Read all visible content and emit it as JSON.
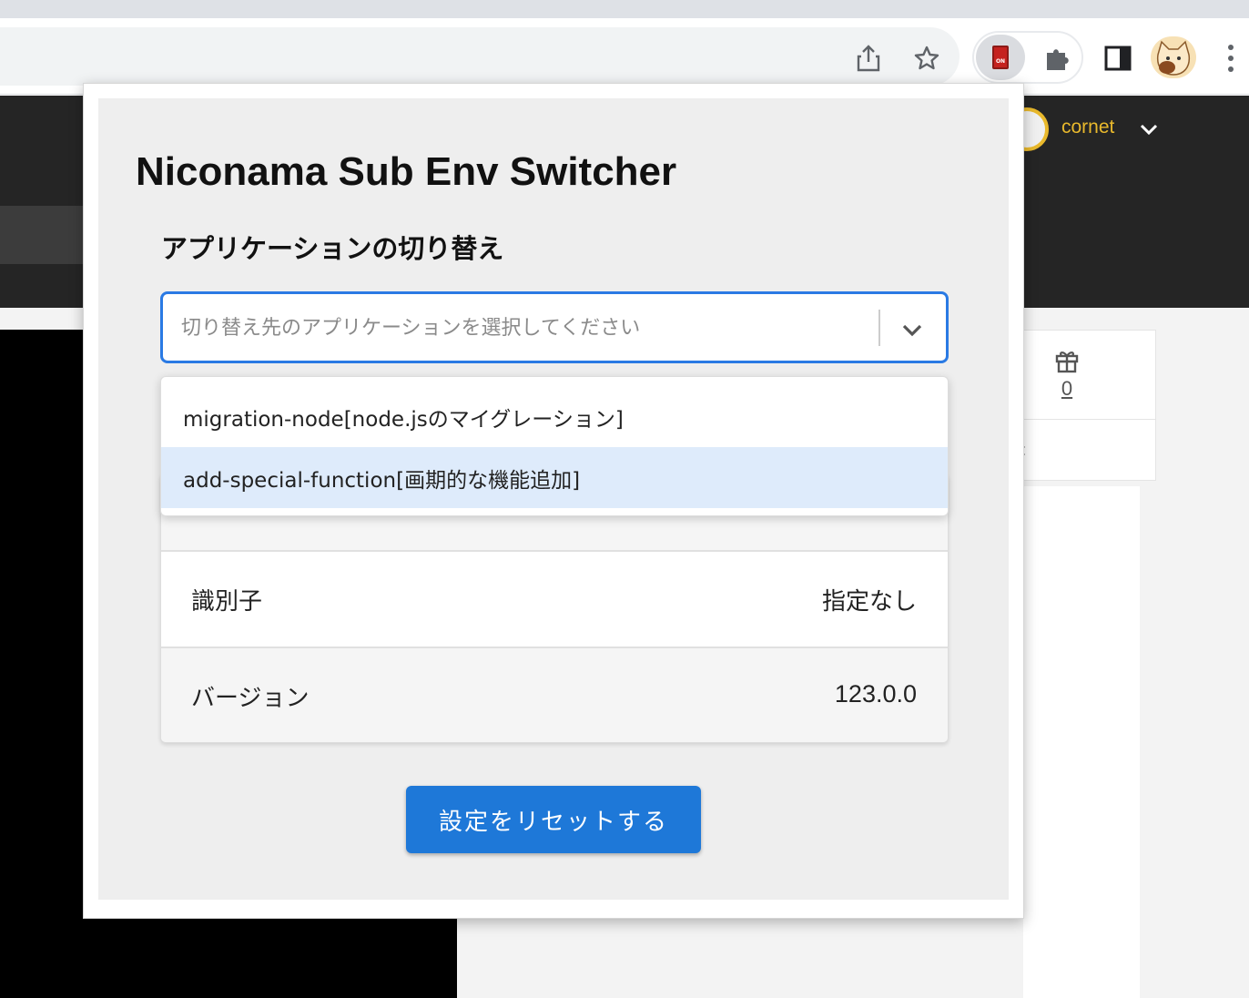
{
  "browser": {
    "icons": {
      "share": "share-icon",
      "bookmark": "star-icon",
      "extension_switch": "switch-on-icon",
      "extensions": "puzzle-icon",
      "side_panel": "side-panel-icon",
      "profile": "cat-avatar-icon",
      "menu": "vertical-dots-icon"
    },
    "extension_switch_label": "ON"
  },
  "page": {
    "user_name": "cornet",
    "gift_count": "0",
    "colors": {
      "header": "#252525",
      "accent": "#e9b92c"
    }
  },
  "popup": {
    "title": "Niconama Sub Env Switcher",
    "section_title": "アプリケーションの切り替え",
    "select": {
      "placeholder": "切り替え先のアプリケーションを選択してください",
      "value": ""
    },
    "options": [
      {
        "label": "migration-node[node.jsのマイグレーション]"
      },
      {
        "label": "add-special-function[画期的な機能追加]",
        "highlighted": true
      }
    ],
    "info": [
      {
        "label": "識別子",
        "value": "指定なし"
      },
      {
        "label": "バージョン",
        "value": "123.0.0"
      }
    ],
    "reset_label": "設定をリセットする",
    "colors": {
      "primary": "#1e78d8",
      "focus_border": "#2a7ae4",
      "option_highlight": "#deebfb"
    }
  }
}
